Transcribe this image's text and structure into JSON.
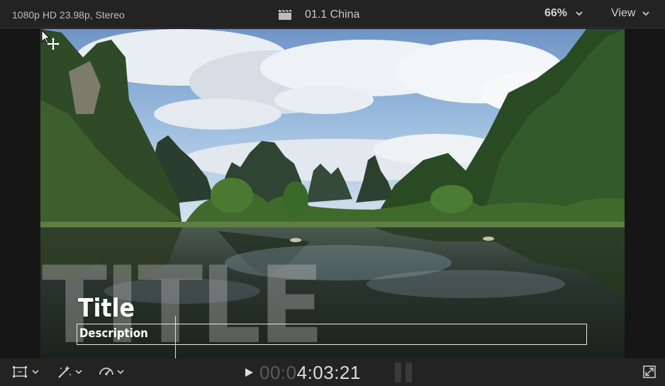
{
  "topbar": {
    "format": "1080p HD 23.98p, Stereo",
    "clip_name": "01.1 China",
    "zoom": "66%",
    "view_label": "View",
    "icons": {
      "clapper": "clapperboard-icon",
      "zoom_menu": "chevron-down-icon",
      "view_menu": "chevron-down-icon"
    }
  },
  "viewer": {
    "background_title": "TITLE",
    "title": "Title",
    "description": "Description"
  },
  "bottombar": {
    "timecode_dim": "00:0",
    "timecode_bright": "4:03:21",
    "icons": [
      "transform-icon",
      "enhance-icon",
      "retime-icon",
      "play-icon",
      "audio-meter-icon",
      "fullscreen-icon"
    ]
  },
  "colors": {
    "accent": "#2c2f55",
    "bar_bg": "#232323"
  }
}
